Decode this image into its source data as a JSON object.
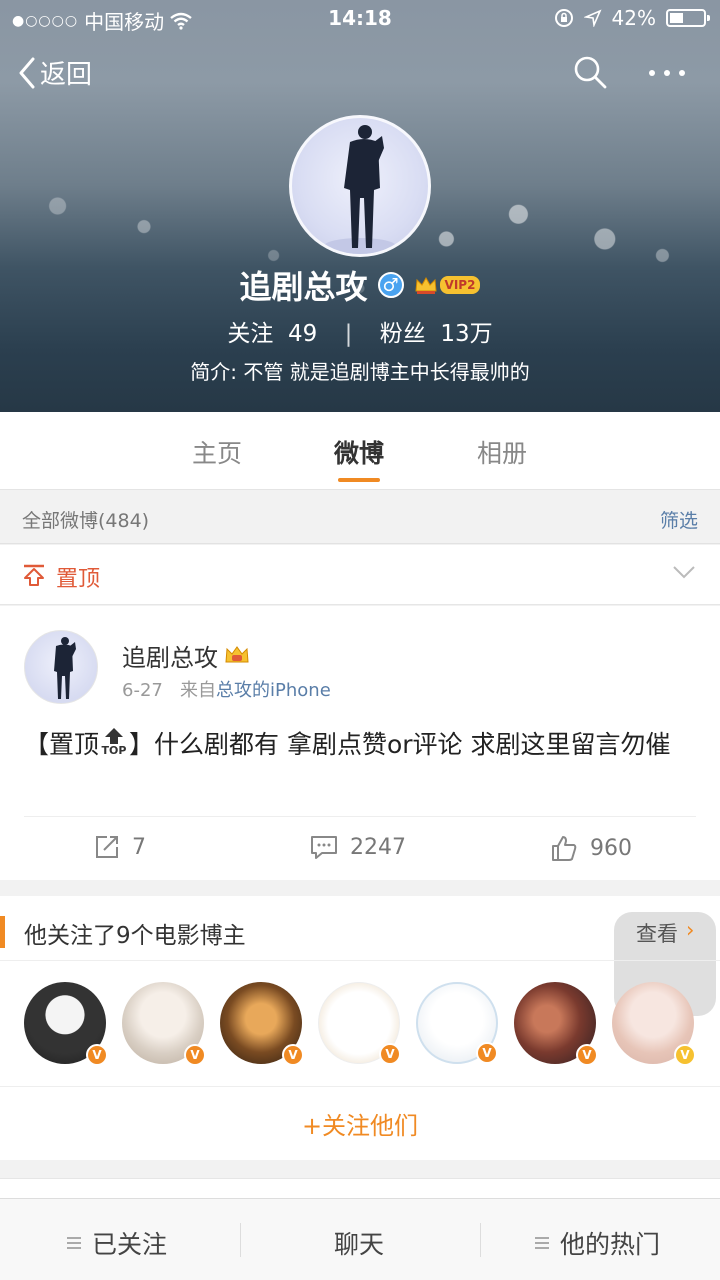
{
  "status_bar": {
    "carrier": "中国移动",
    "signal_dots": "●○○○○",
    "time": "14:18",
    "battery": "42%",
    "battery_level": 0.42
  },
  "nav": {
    "back_label": "返回"
  },
  "profile": {
    "username": "追剧总攻",
    "vip_label": "VIP2",
    "following_label": "关注",
    "following_count": "49",
    "followers_label": "粉丝",
    "followers_count": "13万",
    "bio": "简介: 不管 就是追剧博主中长得最帅的"
  },
  "tabs": [
    {
      "label": "主页",
      "active": false
    },
    {
      "label": "微博",
      "active": true
    },
    {
      "label": "相册",
      "active": false
    }
  ],
  "filter_bar": {
    "count_label": "全部微博(484)",
    "filter_label": "筛选"
  },
  "pinned": {
    "label": "置顶"
  },
  "post": {
    "author": "追剧总攻",
    "date": "6-27",
    "source_prefix": "来自",
    "source": "总攻的iPhone",
    "content_start": "【置顶",
    "content_rest": "】什么剧都有 拿剧点赞or评论 求剧这里留言勿催",
    "top_tag": "TOP",
    "reposts": "7",
    "comments": "2247",
    "likes": "960"
  },
  "follows_card": {
    "title": "他关注了9个电影博主",
    "view_label": "查看",
    "follow_all_label": "+关注他们"
  },
  "bottom_bar": {
    "followed_label": "已关注",
    "chat_label": "聊天",
    "hot_label": "他的热门"
  },
  "colors": {
    "accent": "#f08a23",
    "link": "#5a7ea8",
    "pin": "#e05a38"
  }
}
